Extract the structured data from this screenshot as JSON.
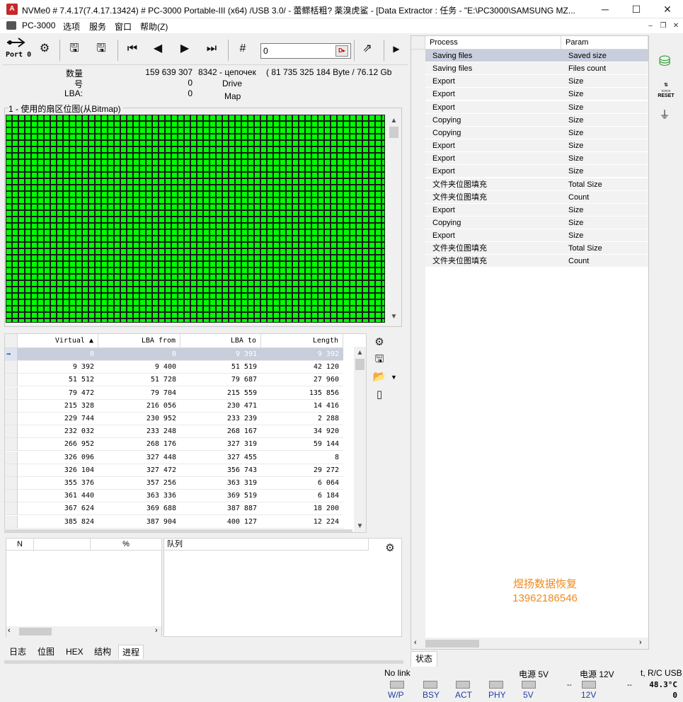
{
  "window": {
    "title": "NVMe0 # 7.4.17(7.4.17.13424) # PC-3000 Portable-III (x64) /USB 3.0/ - 蕾鳏栝粗? 薬溴虎鲨     - [Data Extractor : 任务 - \"E:\\PC3000\\SAMSUNG MZ...",
    "minimize": "─",
    "maximize": "☐",
    "close": "✕"
  },
  "menu": {
    "items": [
      "PC-3000",
      "选项",
      "服务",
      "窗口",
      "帮助(Z)"
    ],
    "mdi": [
      "–",
      "❐",
      "✕"
    ]
  },
  "toolbar": {
    "port_label": "Port 0",
    "goto_value": "0",
    "goto_btn": "D▸"
  },
  "info": {
    "labels": [
      "数量",
      "号",
      "LBA:"
    ],
    "count_value": "159 639 307",
    "chains": "8342 - цепочек",
    "bytes": "( 81 735 325 184 Byte /  76.12 Gb",
    "num_value": "0",
    "lba_value": "0",
    "drive_word": "Drive",
    "map_word": "Map"
  },
  "bitmap": {
    "title": "1 - 使用的扇区位图(从Bitmap)",
    "state_color": "#00ff00"
  },
  "table": {
    "columns": [
      "Virtual ▲",
      "LBA from",
      "LBA to",
      "Length"
    ],
    "rows": [
      [
        "0",
        "0",
        "9 391",
        "9 392"
      ],
      [
        "9 392",
        "9 400",
        "51 519",
        "42 120"
      ],
      [
        "51 512",
        "51 728",
        "79 687",
        "27 960"
      ],
      [
        "79 472",
        "79 704",
        "215 559",
        "135 856"
      ],
      [
        "215 328",
        "216 056",
        "230 471",
        "14 416"
      ],
      [
        "229 744",
        "230 952",
        "233 239",
        "2 288"
      ],
      [
        "232 032",
        "233 248",
        "268 167",
        "34 920"
      ],
      [
        "266 952",
        "268 176",
        "327 319",
        "59 144"
      ],
      [
        "326 096",
        "327 448",
        "327 455",
        "8"
      ],
      [
        "326 104",
        "327 472",
        "356 743",
        "29 272"
      ],
      [
        "355 376",
        "357 256",
        "363 319",
        "6 064"
      ],
      [
        "361 440",
        "363 336",
        "369 519",
        "6 184"
      ],
      [
        "367 624",
        "369 688",
        "387 887",
        "18 200"
      ],
      [
        "385 824",
        "387 904",
        "400 127",
        "12 224"
      ]
    ]
  },
  "progress_panel": {
    "col_n": "N",
    "col_pct": "%",
    "queue_label": "队列"
  },
  "tabs": [
    "日志",
    "位图",
    "HEX",
    "结构",
    "进程"
  ],
  "process_table": {
    "columns": [
      "Process",
      "Param"
    ],
    "rows": [
      [
        "Saving files",
        "Saved size"
      ],
      [
        "Saving files",
        "Files count"
      ],
      [
        "Export",
        "Size"
      ],
      [
        "Export",
        "Size"
      ],
      [
        "Export",
        "Size"
      ],
      [
        "Copying",
        "Size"
      ],
      [
        "Copying",
        "Size"
      ],
      [
        "Export",
        "Size"
      ],
      [
        "Export",
        "Size"
      ],
      [
        "Export",
        "Size"
      ],
      [
        "文件夹位图填充",
        "Total Size"
      ],
      [
        "文件夹位图填充",
        "Count"
      ],
      [
        "Export",
        "Size"
      ],
      [
        "Copying",
        "Size"
      ],
      [
        "Export",
        "Size"
      ],
      [
        "文件夹位图填充",
        "Total Size"
      ],
      [
        "文件夹位图填充",
        "Count"
      ]
    ]
  },
  "watermark": {
    "line1": "煜扬数据恢复",
    "line2": "13962186546"
  },
  "status_tab": "状态",
  "statusbar": {
    "no_link": "No link",
    "leds": [
      "W/P",
      "BSY",
      "ACT",
      "PHY"
    ],
    "power5": "电源 5V",
    "power5_led": "5V",
    "power5_val": "--",
    "power12": "电源 12V",
    "power12_led": "12V",
    "power12_val": "--",
    "temp_label": "t, R/C USB",
    "temp_value": "48.3°C",
    "rc_value": "0"
  }
}
